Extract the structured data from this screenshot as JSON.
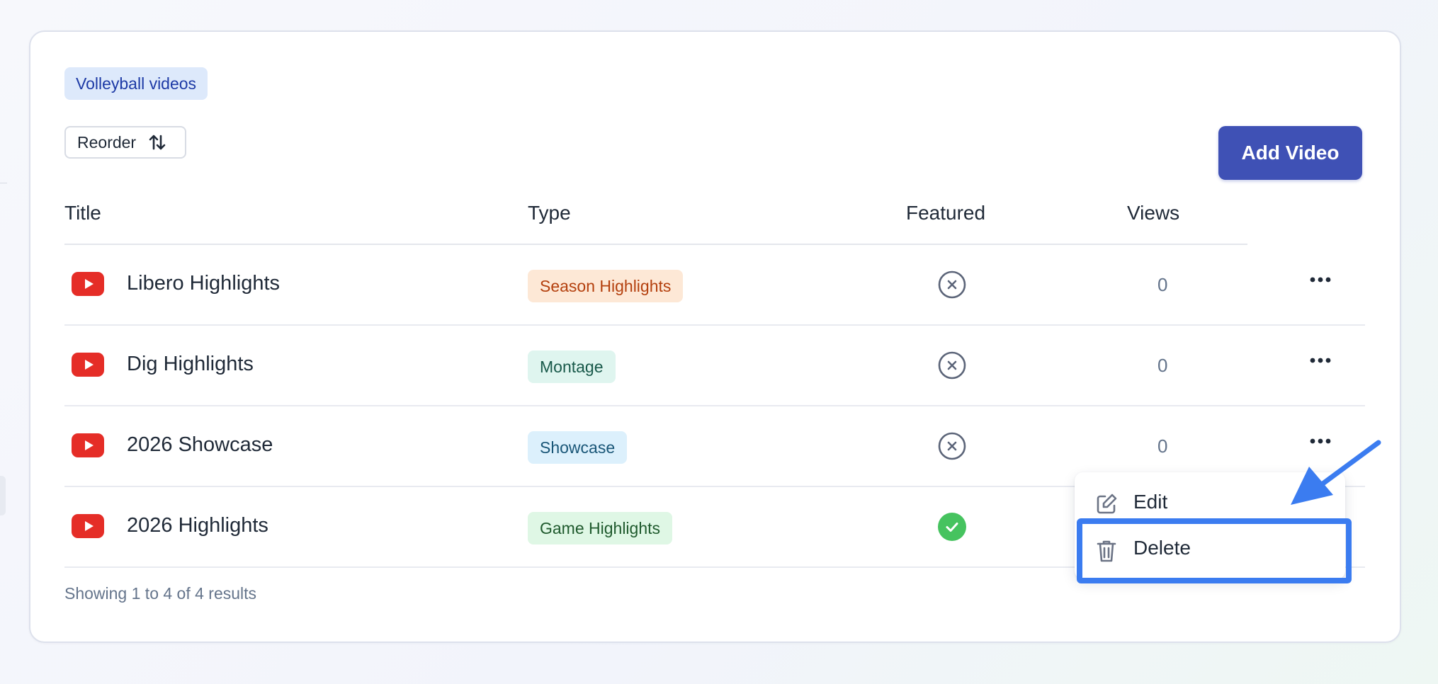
{
  "collection": {
    "tag_label": "Volleyball videos"
  },
  "toolbar": {
    "reorder_label": "Reorder",
    "add_video_label": "Add Video"
  },
  "table": {
    "headers": {
      "title": "Title",
      "type": "Type",
      "featured": "Featured",
      "views": "Views"
    },
    "rows": [
      {
        "title": "Libero Highlights",
        "type": "Season Highlights",
        "featured": false,
        "views": "0"
      },
      {
        "title": "Dig Highlights",
        "type": "Montage",
        "featured": false,
        "views": "0"
      },
      {
        "title": "2026 Showcase",
        "type": "Showcase",
        "featured": false,
        "views": "0"
      },
      {
        "title": "2026 Highlights",
        "type": "Game Highlights",
        "featured": true,
        "views": ""
      }
    ]
  },
  "pagination": {
    "summary": "Showing 1 to 4 of 4 results"
  },
  "context_menu": {
    "edit_label": "Edit",
    "delete_label": "Delete"
  },
  "icons": {
    "video": "youtube-play-icon",
    "not_featured": "circle-x-icon",
    "featured": "check-circle-icon",
    "row_actions": "more-horizontal-icon",
    "reorder": "arrows-up-down-icon",
    "edit": "pencil-square-icon",
    "delete": "trash-icon"
  },
  "colors": {
    "primary": "#3f51b5",
    "highlight": "#3b7cf0",
    "youtube": "#e52d27",
    "featured_green": "#46c35f"
  }
}
